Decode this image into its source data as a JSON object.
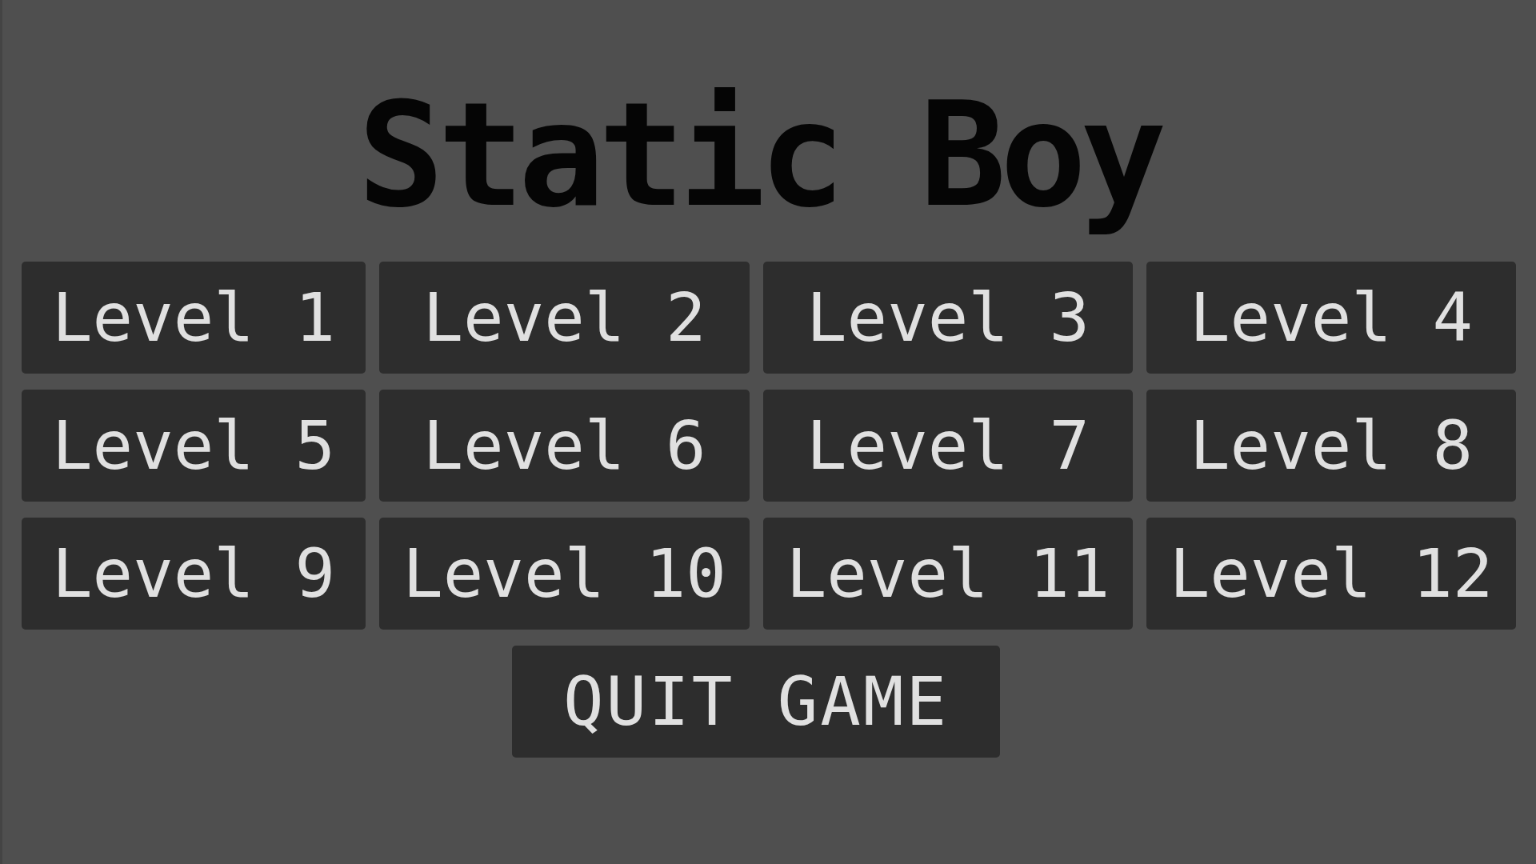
{
  "title": "Static Boy",
  "levels": [
    "Level 1",
    "Level 2",
    "Level 3",
    "Level 4",
    "Level 5",
    "Level 6",
    "Level 7",
    "Level 8",
    "Level 9",
    "Level 10",
    "Level 11",
    "Level 12"
  ],
  "quit_button": "QUIT GAME"
}
